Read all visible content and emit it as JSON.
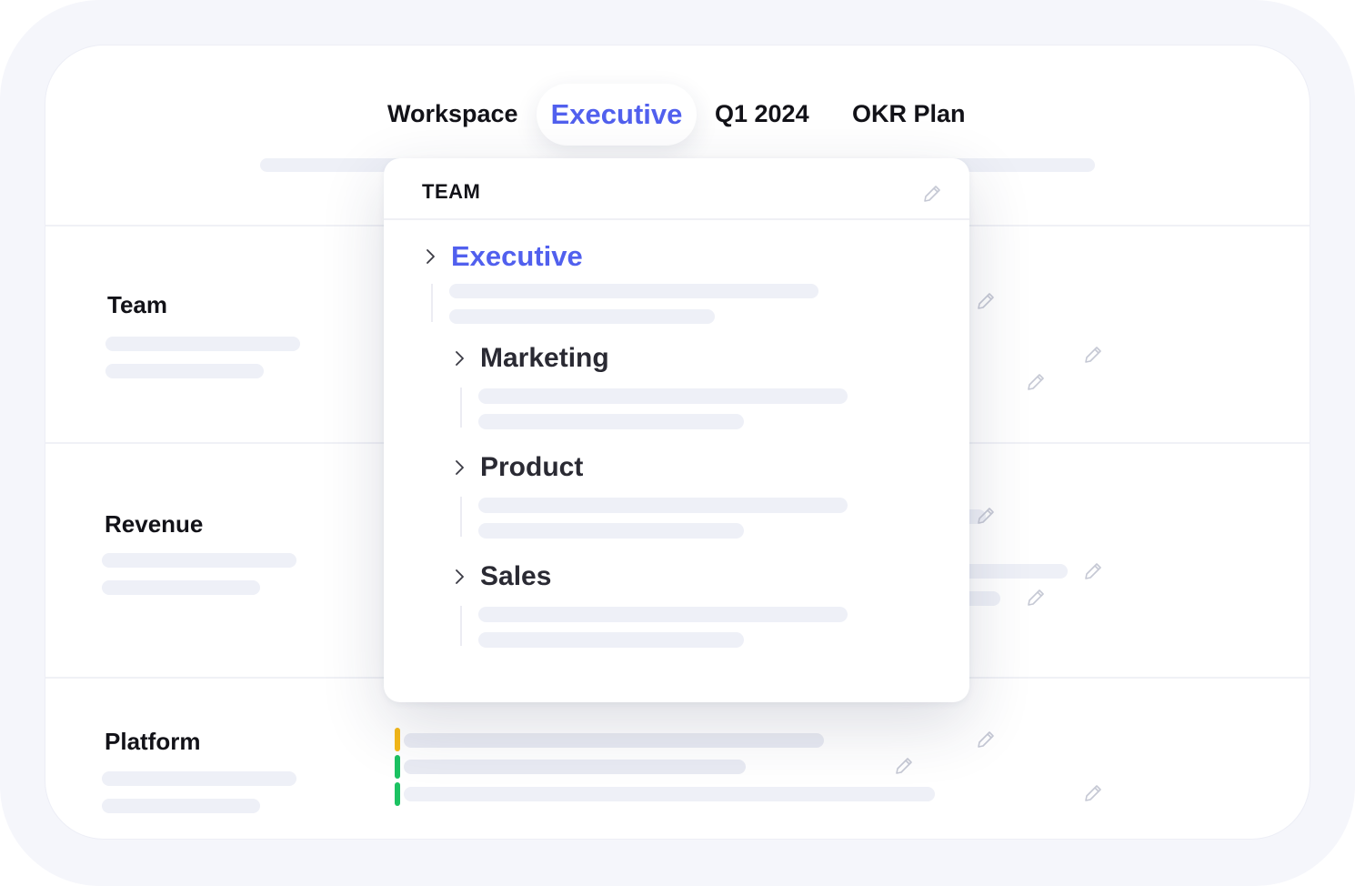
{
  "tabs": [
    {
      "label": "Workspace",
      "active": false
    },
    {
      "label": "Executive",
      "active": true
    },
    {
      "label": "Q1 2024",
      "active": false
    },
    {
      "label": "OKR Plan",
      "active": false
    }
  ],
  "rows": [
    {
      "label": "Team"
    },
    {
      "label": "Revenue"
    },
    {
      "label": "Platform"
    }
  ],
  "popover": {
    "title": "TEAM",
    "icon": "pencil-icon",
    "nodes": [
      {
        "label": "Executive",
        "icon": "chevron-right-icon",
        "active": true
      },
      {
        "label": "Marketing",
        "icon": "chevron-right-icon",
        "active": false
      },
      {
        "label": "Product",
        "icon": "chevron-right-icon",
        "active": false
      },
      {
        "label": "Sales",
        "icon": "chevron-right-icon",
        "active": false
      }
    ]
  },
  "colors": {
    "accent": "#5160ee",
    "status_warning": "#f5b918",
    "status_success": "#1cc262",
    "placeholder": "#eef0f7",
    "frame": "#f5f6fb"
  }
}
